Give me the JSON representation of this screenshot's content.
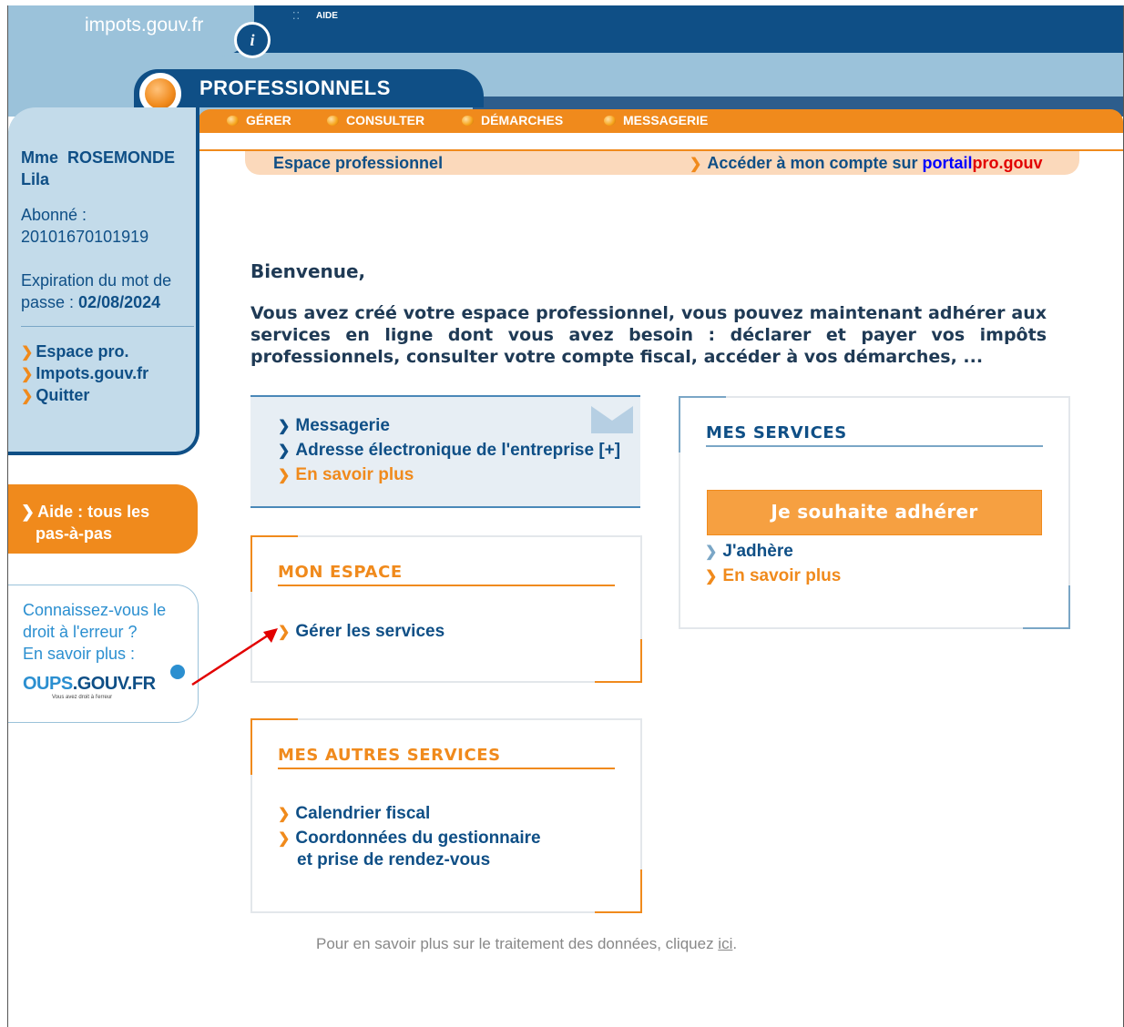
{
  "header": {
    "brand": "impots.gouv.fr",
    "brand_logo_glyph": "i",
    "aide": "AIDE",
    "section": "PROFESSIONNELS",
    "nav": [
      "GÉRER",
      "CONSULTER",
      "DÉMARCHES",
      "MESSAGERIE"
    ]
  },
  "breadcrumb": {
    "left": "Espace professionnel",
    "right_prefix": "Accéder à mon compte sur ",
    "right_portail": "portail",
    "right_pro": "pro.gouv"
  },
  "sidebar": {
    "user_name_line1": "Mme  ROSEMONDE",
    "user_name_line2": "Lila",
    "abonne_label": "Abonné :",
    "abonne_number": "20101670101919",
    "expiration_line1": "Expiration du mot de",
    "expiration_line2_prefix": "passe : ",
    "expiration_date": "02/08/2024",
    "links": [
      "Espace pro.",
      "Impots.gouv.fr",
      "Quitter"
    ],
    "aide_line1": "Aide : tous les",
    "aide_line2": "pas-à-pas",
    "oups_line1": "Connaissez-vous le",
    "oups_line2": "droit à l'erreur ?",
    "oups_line3": "En savoir plus :",
    "oups_logo_a": "OUPS",
    "oups_logo_b": ".GOUV.FR",
    "oups_tagline": "Vous avez droit à l'erreur"
  },
  "main": {
    "welcome": "Bienvenue,",
    "intro": "Vous avez créé votre espace professionnel, vous pouvez maintenant adhérer aux services en ligne dont vous avez besoin : déclarer et payer vos impôts professionnels, consulter votre compte fiscal, accéder à vos démarches, ...",
    "messagerie_links": [
      "Messagerie",
      "Adresse électronique de l'entreprise [+]"
    ],
    "messagerie_more": "En savoir plus",
    "mon_espace": {
      "title": "MON ESPACE",
      "link": "Gérer les services"
    },
    "mes_autres_services": {
      "title": "MES AUTRES SERVICES",
      "link1": "Calendrier fiscal",
      "link2_line1": "Coordonnées du gestionnaire",
      "link2_line2": "et prise de rendez-vous"
    },
    "mes_services": {
      "title": "MES SERVICES",
      "button": "Je souhaite adhérer",
      "link": "J'adhère",
      "more": "En savoir plus"
    },
    "footer_prefix": "Pour en savoir plus sur le traitement des données, cliquez ",
    "footer_link": "ici",
    "footer_suffix": "."
  },
  "colors": {
    "navy": "#0f4f86",
    "orange": "#f08a1c",
    "light_blue": "#9bc2da",
    "annotation_arrow": "#e20000"
  }
}
